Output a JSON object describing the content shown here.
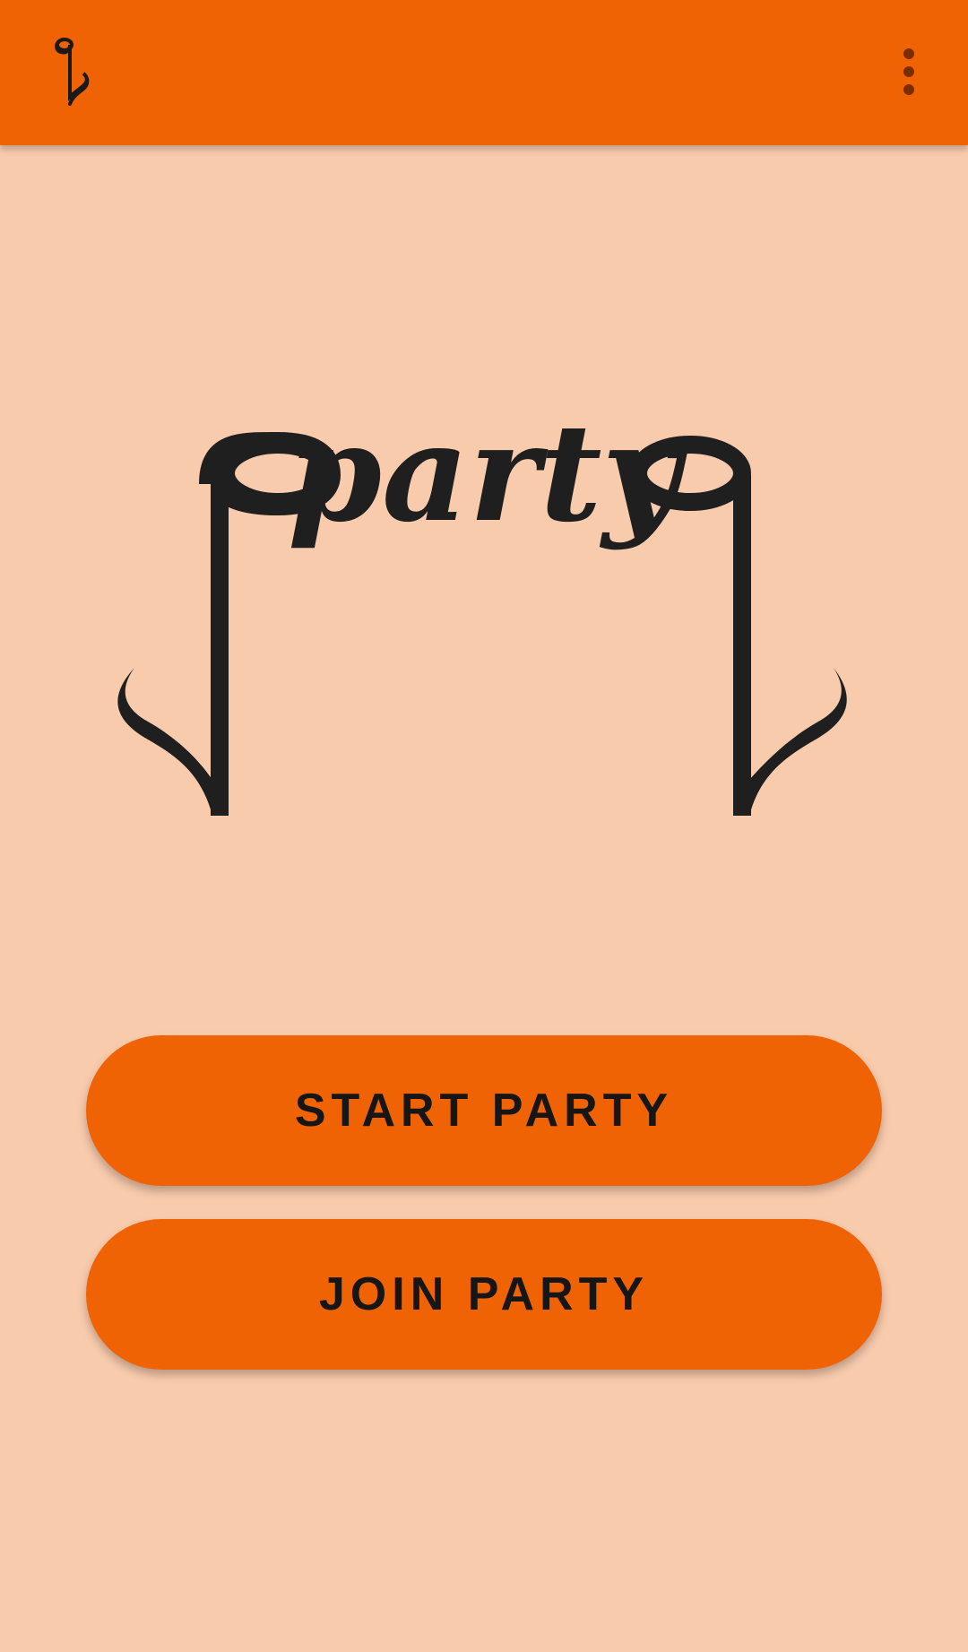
{
  "app_bar": {
    "logo_icon": "music-note-icon",
    "menu_icon": "more-vert-icon"
  },
  "hero": {
    "logo_text": "party",
    "decoration": "music-note-bracket"
  },
  "actions": {
    "start_label": "START PARTY",
    "join_label": "JOIN PARTY"
  },
  "colors": {
    "primary": "#f06305",
    "background": "#f9cbad",
    "ink": "#1f1f1f"
  }
}
